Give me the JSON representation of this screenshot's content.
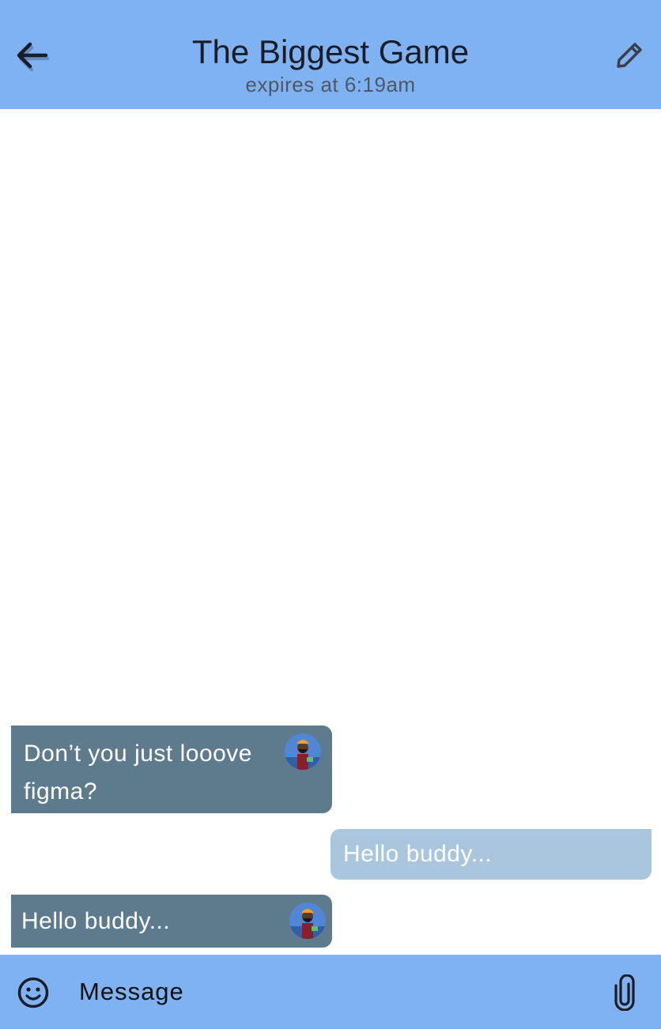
{
  "header": {
    "title": "The Biggest Game",
    "subtitle": "expires at 6:19am",
    "back_icon": "arrow-left-icon",
    "edit_icon": "pencil-icon"
  },
  "messages": [
    {
      "direction": "incoming",
      "text": "Don’t you just looove figma?",
      "avatar": "avatar-icon"
    },
    {
      "direction": "outgoing",
      "text": "Hello buddy..."
    },
    {
      "direction": "incoming",
      "text": "Hello buddy...",
      "avatar": "avatar-icon"
    }
  ],
  "composer": {
    "placeholder": "Message",
    "emoji_icon": "emoji-icon",
    "attach_icon": "paperclip-icon"
  },
  "colors": {
    "header_bg": "#7fb2f2",
    "incoming_bubble": "#5e7b8e",
    "outgoing_bubble": "#a9c6de",
    "text_dark": "#1b1d26"
  }
}
